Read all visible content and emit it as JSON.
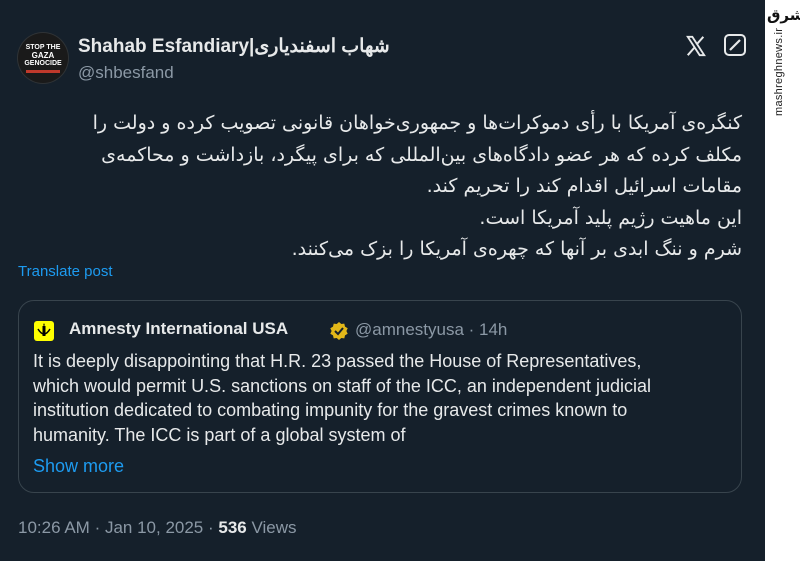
{
  "author": {
    "display_name": "Shahab Esfandiary|شهاب اسفندیاری",
    "handle": "@shbesfand",
    "avatar_lines": [
      "STOP THE",
      "GAZA",
      "GENOCIDE"
    ]
  },
  "post": {
    "lines": [
      "کنگره‌ی آمریکا با رأی دموکرات‌ها و جمهوری‌خواهان قانونی تصویب کرده و دولت را",
      "مکلف کرده که هر عضو دادگاه‌های بین‌المللی که برای پیگرد، بازداشت و محاکمه‌ی",
      "مقامات اسرائیل اقدام کند را تحریم کند.",
      "این ماهیت رژیم پلید آمریکا است.",
      "شرم و ننگ ابدی بر آنها که چهره‌ی آمریکا را بزک می‌کنند."
    ],
    "translate_label": "Translate post"
  },
  "quote": {
    "name": "Amnesty International USA",
    "handle_time": "@amnestyusa · 14h",
    "lines": [
      "It is deeply disappointing that H.R. 23 passed the House of Representatives,",
      "which would permit U.S. sanctions on staff of the ICC, an independent judicial",
      "institution dedicated to combating impunity for the gravest crimes known to",
      "humanity. The ICC is part of a global system of"
    ],
    "show_more": "Show more"
  },
  "meta": {
    "time": "10:26 AM",
    "date": "Jan 10, 2025",
    "views_count": "536",
    "views_label": "Views"
  },
  "watermark": {
    "logo": "مشرق",
    "url": "mashreghnews.ir"
  },
  "colors": {
    "background": "#15202b",
    "link": "#1d9bf0",
    "secondary_text": "#8b98a5",
    "border": "#38444d"
  }
}
